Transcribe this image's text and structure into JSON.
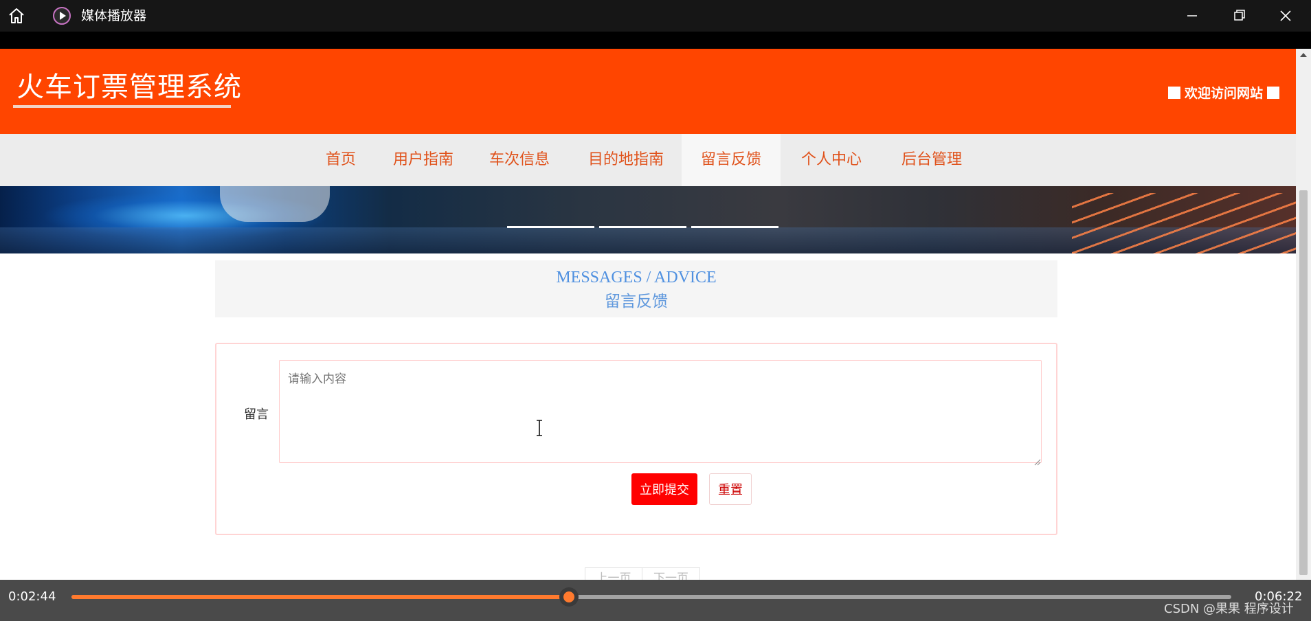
{
  "player": {
    "title": "媒体播放器",
    "current_time": "0:02:44",
    "total_time": "0:06:22",
    "progress": 0.429,
    "accent_color": "#ff7a2e",
    "icons": [
      "home-icon",
      "media-player-icon",
      "minimize-icon",
      "maximize-icon",
      "close-icon"
    ]
  },
  "site": {
    "title": "火车订票管理系统",
    "welcome": "欢迎访问网站",
    "brand_color": "#ff4500"
  },
  "nav": {
    "items": [
      {
        "label": "首页"
      },
      {
        "label": "用户指南"
      },
      {
        "label": "车次信息"
      },
      {
        "label": "目的地指南"
      },
      {
        "label": "留言反馈"
      },
      {
        "label": "个人中心"
      },
      {
        "label": "后台管理"
      }
    ],
    "active": "留言反馈"
  },
  "messages": {
    "title_en": "MESSAGES / ADVICE",
    "title_cn": "留言反馈"
  },
  "form": {
    "label": "留言",
    "placeholder": "请输入内容",
    "value": "",
    "submit_label": "立即提交",
    "reset_label": "重置",
    "submit_color": "#ff0000"
  },
  "pager": {
    "prev_label": "上一页",
    "next_label": "下一页"
  },
  "watermark": "CSDN @果果 程序设计"
}
